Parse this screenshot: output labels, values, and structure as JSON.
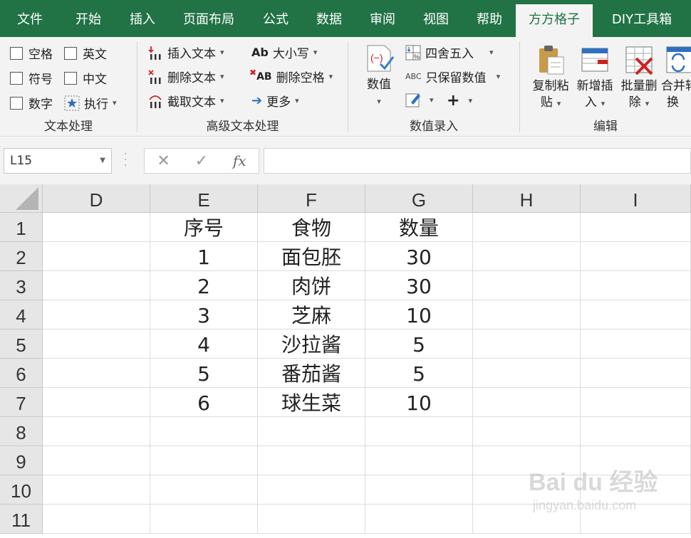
{
  "tabs": [
    "文件",
    "开始",
    "插入",
    "页面布局",
    "公式",
    "数据",
    "审阅",
    "视图",
    "帮助",
    "方方格子",
    "DIY工具箱"
  ],
  "active_tab_index": 9,
  "ribbon": {
    "text_group": {
      "label": "文本处理",
      "items": [
        "空格",
        "英文",
        "符号",
        "中文",
        "数字",
        "执行"
      ]
    },
    "advanced_group": {
      "label": "高级文本处理",
      "insert_text": "插入文本",
      "delete_text": "删除文本",
      "extract_text": "截取文本",
      "case": "大小写",
      "delete_space": "删除空格",
      "more": "更多"
    },
    "number_group": {
      "label": "数值录入",
      "number": "数值",
      "round": "四舍五入",
      "keep_number": "只保留数值"
    },
    "edit_group": {
      "label": "编辑",
      "copy_paste": [
        "复制粘",
        "贴"
      ],
      "insert_new": [
        "新增插",
        "入"
      ],
      "batch_delete": [
        "批量删",
        "除"
      ],
      "merge_convert": [
        "合并转",
        "换"
      ]
    }
  },
  "formula_bar": {
    "name_box": "L15",
    "fx_label": "fx",
    "formula": ""
  },
  "grid": {
    "columns": [
      "D",
      "E",
      "F",
      "G",
      "H",
      "I"
    ],
    "rows": [
      "1",
      "2",
      "3",
      "4",
      "5",
      "6",
      "7",
      "8",
      "9",
      "10",
      "11"
    ],
    "cells": [
      [
        "",
        "序号",
        "食物",
        "数量",
        "",
        ""
      ],
      [
        "",
        "1",
        "面包胚",
        "30",
        "",
        ""
      ],
      [
        "",
        "2",
        "肉饼",
        "30",
        "",
        ""
      ],
      [
        "",
        "3",
        "芝麻",
        "10",
        "",
        ""
      ],
      [
        "",
        "4",
        "沙拉酱",
        "5",
        "",
        ""
      ],
      [
        "",
        "5",
        "番茄酱",
        "5",
        "",
        ""
      ],
      [
        "",
        "6",
        "球生菜",
        "10",
        "",
        ""
      ],
      [
        "",
        "",
        "",
        "",
        "",
        ""
      ],
      [
        "",
        "",
        "",
        "",
        "",
        ""
      ],
      [
        "",
        "",
        "",
        "",
        "",
        ""
      ],
      [
        "",
        "",
        "",
        "",
        "",
        ""
      ]
    ]
  },
  "watermark": {
    "main": "Bai du 经验",
    "sub": "jingyan.baidu.com"
  },
  "colors": {
    "tab_bar": "#217346",
    "ribbon_bg": "#f3f3f3",
    "header_bg": "#e6e6e6"
  }
}
